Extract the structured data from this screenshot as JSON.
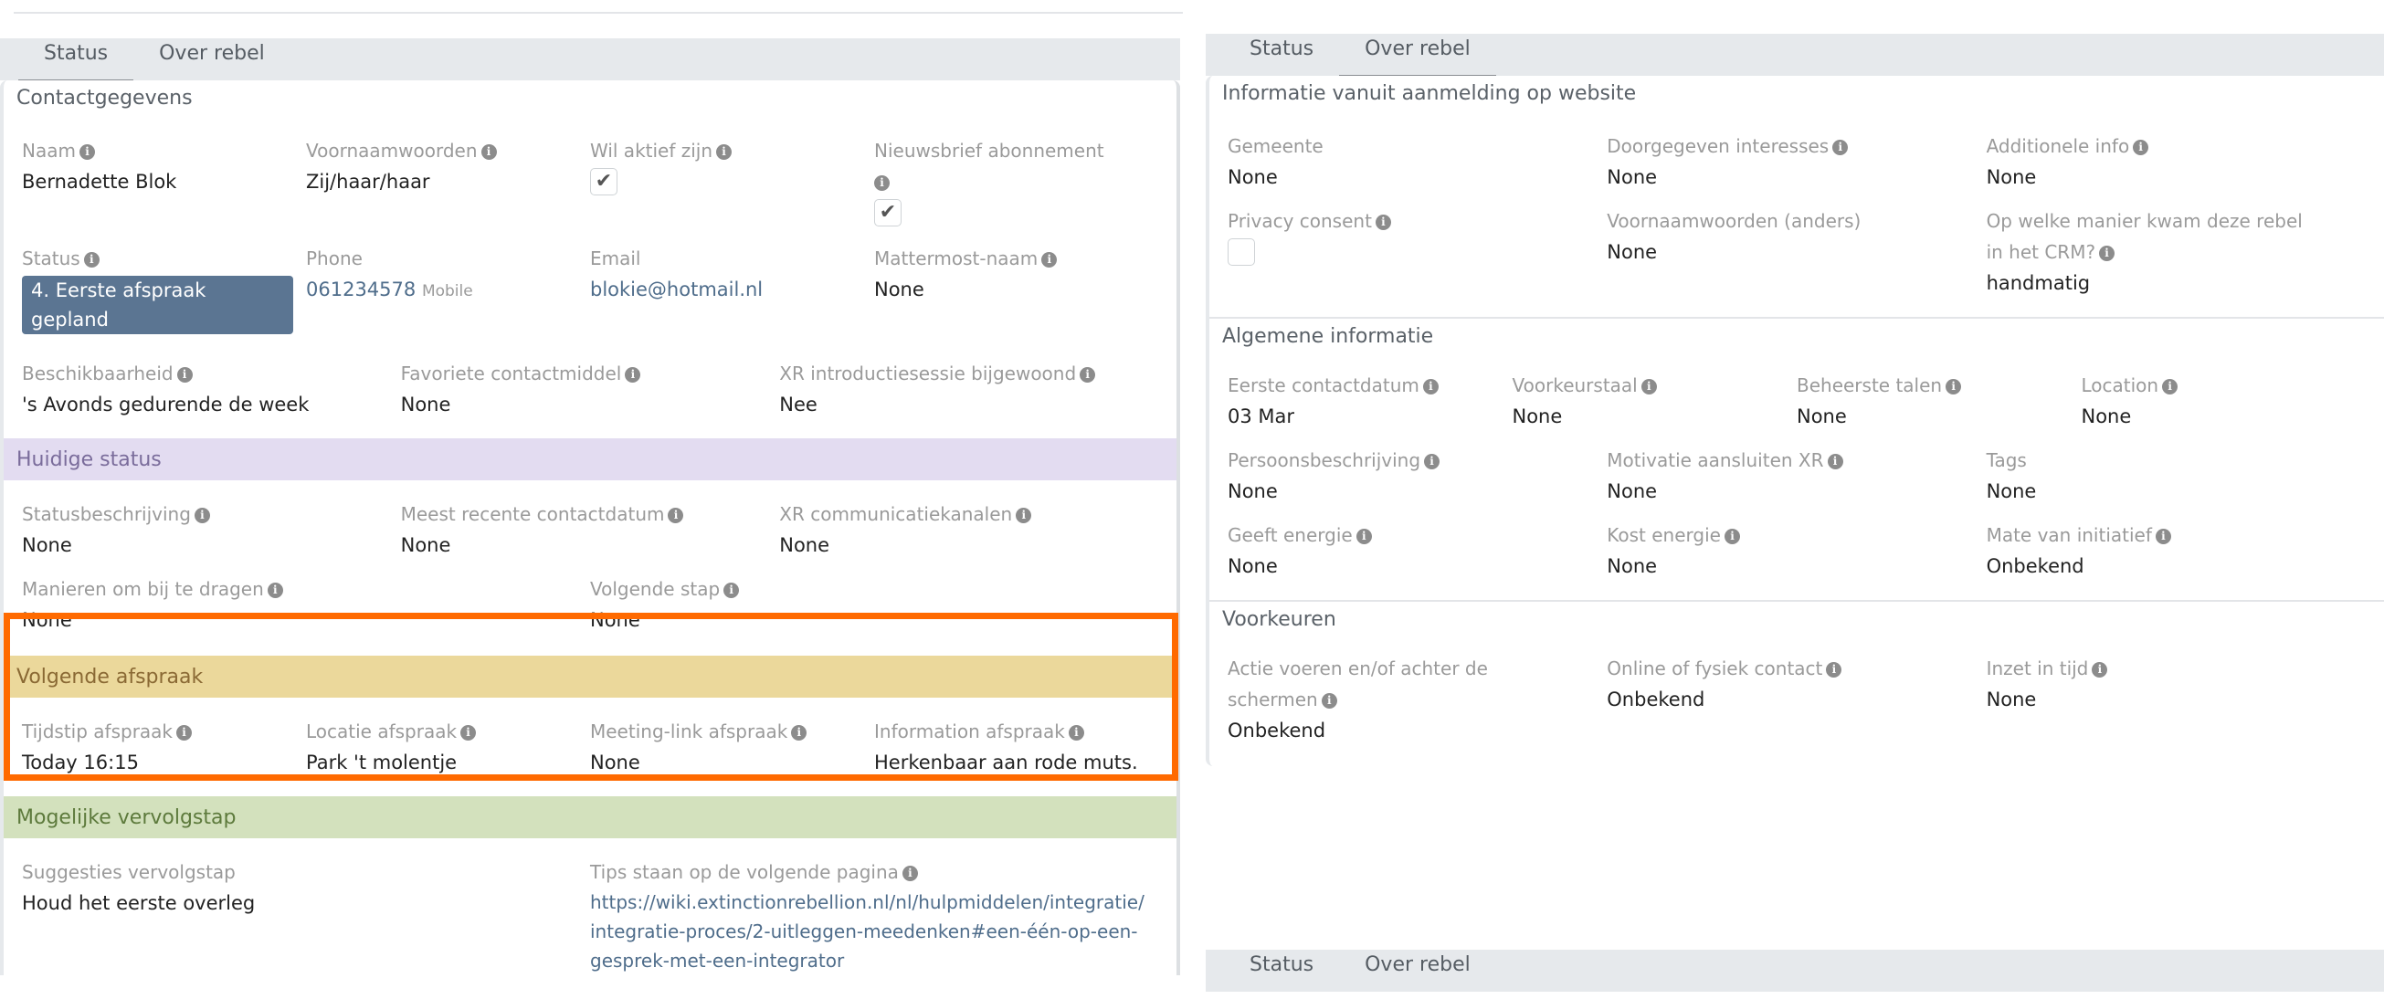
{
  "left": {
    "tabs": [
      {
        "label": "Status",
        "active": true
      },
      {
        "label": "Over rebel",
        "active": false
      }
    ],
    "contact": {
      "title": "Contactgegevens",
      "naam": {
        "label": "Naam",
        "value": "Bernadette Blok"
      },
      "voornaamwoorden": {
        "label": "Voornaamwoorden",
        "value": "Zij/haar/haar"
      },
      "wil_aktief": {
        "label": "Wil aktief zijn",
        "checked": true,
        "check_glyph": "✔"
      },
      "nieuwsbrief": {
        "label": "Nieuwsbrief abonnement",
        "checked": true,
        "check_glyph": "✔"
      },
      "status": {
        "label": "Status",
        "value": "4. Eerste afspraak gepland",
        "badge_color": "#5b7592"
      },
      "phone": {
        "label": "Phone",
        "value": "061234578",
        "type": "Mobile"
      },
      "email": {
        "label": "Email",
        "value": "blokie@hotmail.nl"
      },
      "mattermost": {
        "label": "Mattermost-naam",
        "value": "None"
      },
      "beschikbaarheid": {
        "label": "Beschikbaarheid",
        "value": "'s Avonds gedurende de week"
      },
      "favoriete": {
        "label": "Favoriete contactmiddel",
        "value": "None"
      },
      "xr_intro": {
        "label": "XR introductiesessie bijgewoond",
        "value": "Nee"
      }
    },
    "huidige_status": {
      "title": "Huidige status",
      "statusbeschrijving": {
        "label": "Statusbeschrijving",
        "value": "None"
      },
      "recente_contactdatum": {
        "label": "Meest recente contactdatum",
        "value": "None"
      },
      "communicatiekanalen": {
        "label": "XR communicatiekanalen",
        "value": "None"
      },
      "manieren": {
        "label": "Manieren om bij te dragen",
        "value": "None"
      },
      "volgende_stap": {
        "label": "Volgende stap",
        "value": "None"
      }
    },
    "volgende_afspraak": {
      "title": "Volgende afspraak",
      "tijdstip": {
        "label": "Tijdstip afspraak",
        "value": "Today 16:15"
      },
      "locatie": {
        "label": "Locatie afspraak",
        "value": "Park 't molentje"
      },
      "meeting_link": {
        "label": "Meeting-link afspraak",
        "value": "None"
      },
      "information": {
        "label": "Information afspraak",
        "value": "Herkenbaar aan rode muts."
      }
    },
    "mogelijke_vervolgstap": {
      "title": "Mogelijke vervolgstap",
      "suggesties": {
        "label": "Suggesties vervolgstap",
        "value": "Houd het eerste overleg"
      },
      "tips": {
        "label": "Tips staan op de volgende pagina",
        "value": "https://wiki.extinctionrebellion.nl/nl/hulpmiddelen/integratie/integratie-proces/2-uitleggen-meedenken#een-één-op-een-gesprek-met-een-integrator"
      }
    }
  },
  "right": {
    "tabs": [
      {
        "label": "Status",
        "active": false
      },
      {
        "label": "Over rebel",
        "active": true
      }
    ],
    "aanmelding": {
      "title": "Informatie vanuit aanmelding op website",
      "gemeente": {
        "label": "Gemeente",
        "value": "None"
      },
      "interesses": {
        "label": "Doorgegeven interesses",
        "value": "None"
      },
      "additionele": {
        "label": "Additionele info",
        "value": "None"
      },
      "privacy": {
        "label": "Privacy consent",
        "checked": false
      },
      "voornaamwoorden_anders": {
        "label": "Voornaamwoorden (anders)",
        "value": "None"
      },
      "crm_manier": {
        "label": "Op welke manier kwam deze rebel in het CRM?",
        "value": "handmatig"
      }
    },
    "algemeen": {
      "title": "Algemene informatie",
      "eerste_contact": {
        "label": "Eerste contactdatum",
        "value": "03 Mar"
      },
      "voorkeurstaal": {
        "label": "Voorkeurstaal",
        "value": "None"
      },
      "talen": {
        "label": "Beheerste talen",
        "value": "None"
      },
      "location": {
        "label": "Location",
        "value": "None"
      },
      "persoonsbeschrijving": {
        "label": "Persoonsbeschrijving",
        "value": "None"
      },
      "motivatie": {
        "label": "Motivatie aansluiten XR",
        "value": "None"
      },
      "tags": {
        "label": "Tags",
        "value": "None"
      },
      "geeft_energie": {
        "label": "Geeft energie",
        "value": "None"
      },
      "kost_energie": {
        "label": "Kost energie",
        "value": "None"
      },
      "initiatief": {
        "label": "Mate van initiatief",
        "value": "Onbekend"
      }
    },
    "voorkeuren": {
      "title": "Voorkeuren",
      "actie": {
        "label": "Actie voeren en/of achter de schermen",
        "value": "Onbekend"
      },
      "online": {
        "label": "Online of fysiek contact",
        "value": "Onbekend"
      },
      "inzet": {
        "label": "Inzet in tijd",
        "value": "None"
      }
    }
  },
  "right_bottom": {
    "tabs": [
      {
        "label": "Status"
      },
      {
        "label": "Over rebel"
      }
    ]
  },
  "info_icon_glyph": "i",
  "highlight_color": "#ff6a00"
}
